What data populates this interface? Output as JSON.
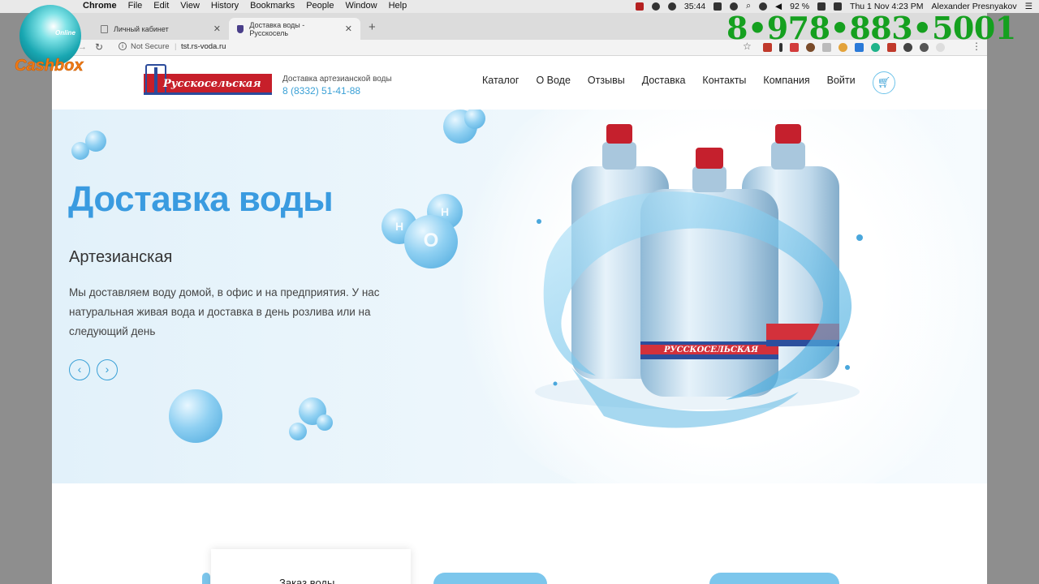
{
  "menubar": {
    "items": [
      "Chrome",
      "File",
      "Edit",
      "View",
      "History",
      "Bookmarks",
      "People",
      "Window",
      "Help"
    ],
    "clock": "35:44",
    "battery": "92 %",
    "datetime": "Thu 1 Nov  4:23 PM",
    "user": "Alexander Presnyakov"
  },
  "browser": {
    "tabs": [
      {
        "title": "Личный кабинет"
      },
      {
        "title": "Доставка воды - Русскосель"
      }
    ],
    "security_label": "Not Secure",
    "url": "tst.rs-voda.ru"
  },
  "header": {
    "logo_text": "Русскосельская",
    "tagline": "Доставка артезианской воды",
    "phone": "8 (8332) 51-41-88",
    "nav": [
      "Каталог",
      "О Воде",
      "Отзывы",
      "Доставка",
      "Контакты",
      "Компания",
      "Войти"
    ]
  },
  "hero": {
    "title": "Доставка воды",
    "subtitle": "Артезианская",
    "description": "Мы доставляем воду домой, в офис и на предприятия. У нас натуральная живая вода и доставка в день розлива или на следующий день",
    "molecule": {
      "h1": "H",
      "h2": "H",
      "o": "O"
    },
    "product_label": "РУССКОСЕЛЬСКАЯ"
  },
  "below": {
    "order_title": "Заказ воды"
  },
  "overlay": {
    "brand": "Cashbox",
    "badge": "Online",
    "phone": "8•978•883•5001"
  },
  "colors": {
    "accent": "#3a9be0",
    "brand_red": "#c71f2a",
    "promo_green": "#15a01f",
    "brand_orange": "#f07a16"
  }
}
